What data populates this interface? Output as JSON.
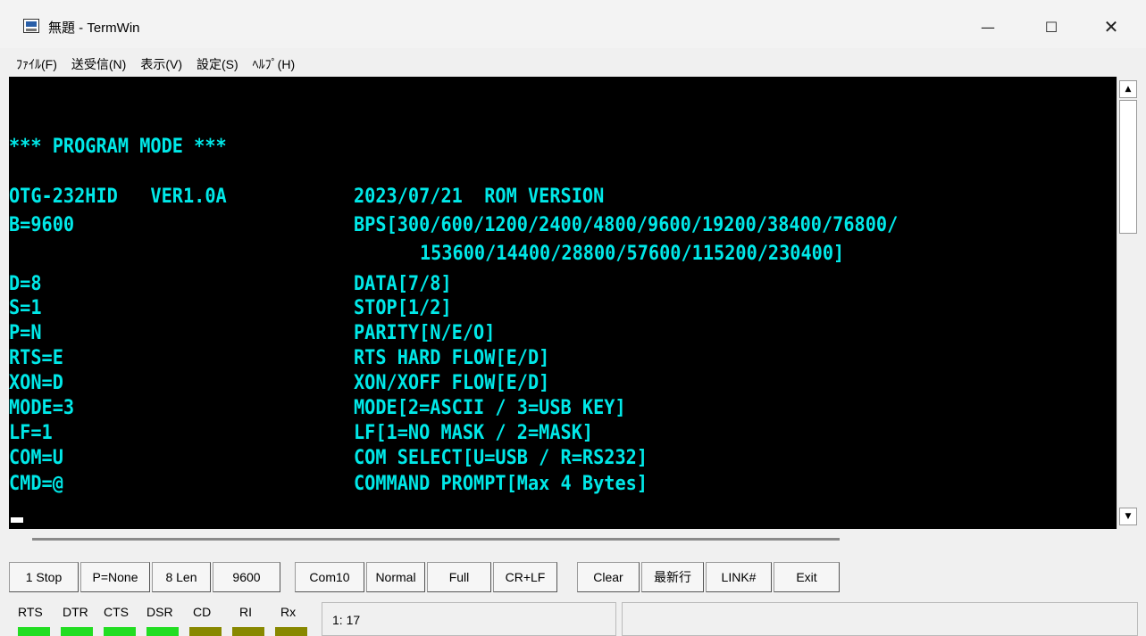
{
  "window": {
    "title": "無題 - TermWin",
    "minimize": "—",
    "maximize": "☐",
    "close": "✕"
  },
  "menu": [
    "ﾌｧｲﾙ(F)",
    "送受信(N)",
    "表示(V)",
    "設定(S)",
    "ﾍﾙﾌﾟ(H)"
  ],
  "terminal": {
    "header": "*** PROGRAM MODE ***",
    "version_left": "OTG-232HID   VER1.0A",
    "version_right": "2023/07/21  ROM VERSION",
    "rows": [
      {
        "setting": "B=9600",
        "description": "BPS[300/600/1200/2400/4800/9600/19200/38400/76800/"
      },
      {
        "setting": "",
        "description": "153600/14400/28800/57600/115200/230400]"
      },
      {
        "setting": "D=8",
        "description": "DATA[7/8]"
      },
      {
        "setting": "S=1",
        "description": "STOP[1/2]"
      },
      {
        "setting": "P=N",
        "description": "PARITY[N/E/O]"
      },
      {
        "setting": "RTS=E",
        "description": "RTS HARD FLOW[E/D]"
      },
      {
        "setting": "XON=D",
        "description": "XON/XOFF FLOW[E/D]"
      },
      {
        "setting": "MODE=3",
        "description": "MODE[2=ASCII / 3=USB KEY]"
      },
      {
        "setting": "LF=1",
        "description": "LF[1=NO MASK / 2=MASK]"
      },
      {
        "setting": "COM=U",
        "description": "COM SELECT[U=USB / R=RS232]"
      },
      {
        "setting": "CMD=@",
        "description": "COMMAND PROMPT[Max 4 Bytes]"
      }
    ]
  },
  "scrollbar": {
    "up": "▲",
    "down": "▼"
  },
  "toolbar": [
    "1 Stop",
    "P=None",
    "8 Len",
    "9600",
    "Com10",
    "Normal",
    "Full",
    "CR+LF",
    "Clear",
    "最新行",
    "LINK#",
    "Exit"
  ],
  "signals": [
    {
      "label": "RTS",
      "state": "on"
    },
    {
      "label": "DTR",
      "state": "on"
    },
    {
      "label": "CTS",
      "state": "on"
    },
    {
      "label": "DSR",
      "state": "on"
    },
    {
      "label": "CD",
      "state": "off"
    },
    {
      "label": "RI",
      "state": "off"
    },
    {
      "label": "Rx",
      "state": "off"
    }
  ],
  "status": {
    "position": "1:  17"
  },
  "colors": {
    "terminal_bg": "#000000",
    "terminal_text": "#00e8e8",
    "led_on": "#22dd22",
    "led_off": "#888800"
  }
}
